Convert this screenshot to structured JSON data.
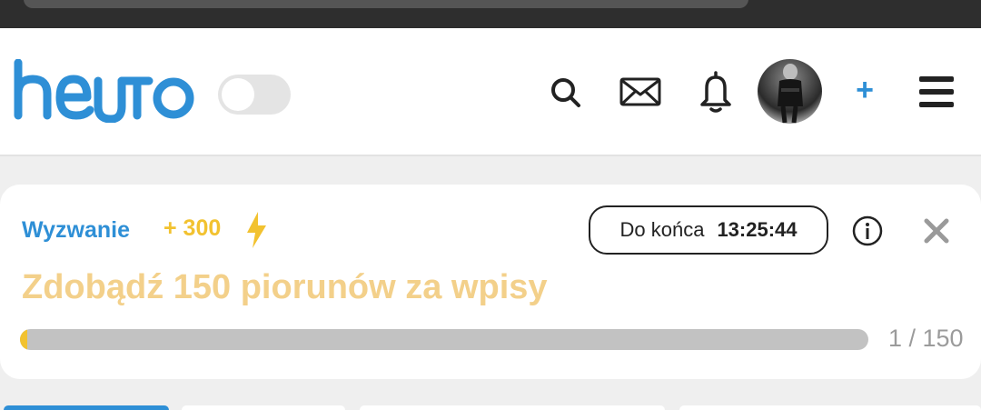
{
  "app": {
    "logo_text": "hejto",
    "theme_toggle_on": false,
    "brand_color": "#2e8fd6",
    "accent_color": "#f2c230"
  },
  "header": {
    "icons": [
      "search-icon",
      "mail-icon",
      "bell-icon",
      "avatar",
      "plus-icon",
      "menu-icon"
    ],
    "plus_label": "+"
  },
  "challenge": {
    "label": "Wyzwanie",
    "points": "+ 300",
    "timer_label": "Do końca",
    "timer_value": "13:25:44",
    "title": "Zdobądź 150 piorunów za wpisy",
    "progress_current": 1,
    "progress_total": 150,
    "progress_text": "1 / 150"
  }
}
